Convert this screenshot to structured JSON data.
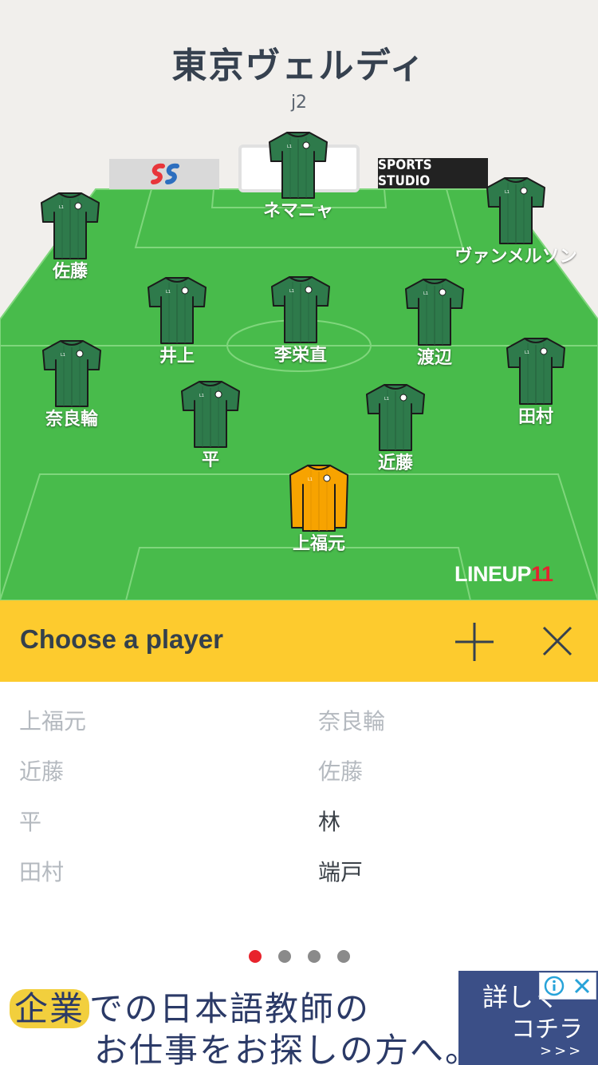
{
  "team": {
    "name": "東京ヴェルディ",
    "league": "j2"
  },
  "players_on_field": [
    {
      "name": "ネマニャ",
      "kit": "outfield"
    },
    {
      "name": "佐藤",
      "kit": "outfield"
    },
    {
      "name": "ヴァンメルソン",
      "kit": "outfield"
    },
    {
      "name": "井上",
      "kit": "outfield"
    },
    {
      "name": "李栄直",
      "kit": "outfield"
    },
    {
      "name": "渡辺",
      "kit": "outfield"
    },
    {
      "name": "奈良輪",
      "kit": "outfield"
    },
    {
      "name": "田村",
      "kit": "outfield"
    },
    {
      "name": "平",
      "kit": "outfield"
    },
    {
      "name": "近藤",
      "kit": "outfield"
    },
    {
      "name": "上福元",
      "kit": "goalkeeper"
    }
  ],
  "ad_boards": {
    "right": "SPORTS STUDIO",
    "left_icon": "ss-logo-icon"
  },
  "branding": {
    "logo_main": "LINEUP",
    "logo_accent": "11"
  },
  "chooser": {
    "title": "Choose a player",
    "add_icon": "plus-icon",
    "close_icon": "close-icon"
  },
  "player_list": [
    {
      "name": "上福元",
      "selected": false
    },
    {
      "name": "奈良輪",
      "selected": false
    },
    {
      "name": "近藤",
      "selected": false
    },
    {
      "name": "佐藤",
      "selected": false
    },
    {
      "name": "平",
      "selected": false
    },
    {
      "name": "林",
      "selected": true
    },
    {
      "name": "田村",
      "selected": false
    },
    {
      "name": "端戸",
      "selected": true
    }
  ],
  "pagination": {
    "pages": 4,
    "current": 1
  },
  "ad_banner": {
    "highlight": "企業",
    "line1_rest": "での日本語教師の",
    "line2": "お仕事をお探しの方へ。",
    "cta_line1": "詳しく",
    "cta_line2": "コチラ",
    "cta_arrows": ">>>"
  },
  "colors": {
    "pitch": "#48bb4b",
    "kit_outfield": "#2e7a4b",
    "kit_goalkeeper": "#f7a300",
    "chooser_bar": "#fdcb2e",
    "dot_active": "#e8232c"
  }
}
